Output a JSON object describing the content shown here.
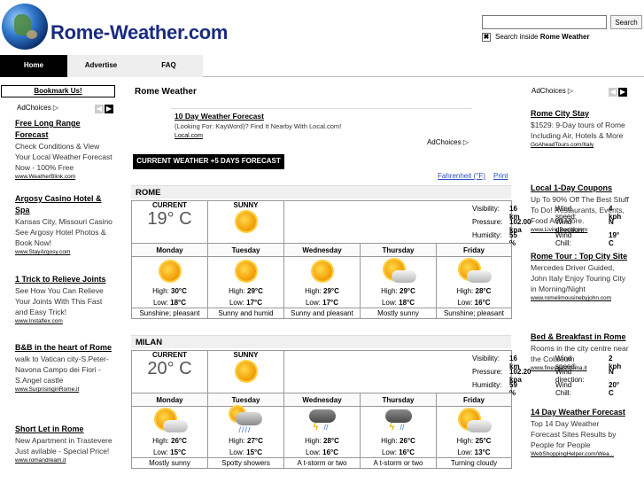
{
  "site": {
    "title": "Rome-Weather.com"
  },
  "search": {
    "button": "Search",
    "option_prefix": "Search inside",
    "option_site": "Rome Weather",
    "check_mark": "✖"
  },
  "nav": {
    "home": "Home",
    "advertise": "Advertise",
    "faq": "FAQ"
  },
  "left": {
    "bookmark": "Bookmark Us!",
    "adchoices": "AdChoices ▷",
    "ads": [
      {
        "title": "Free Long Range Forecast",
        "body": "Check Conditions & View Your Local Weather Forecast Now - 100% Free",
        "url": "www.WeatherBlink.com"
      },
      {
        "title": "Argosy Casino Hotel & Spa",
        "body": "Kansas City, Missouri Casino See Argosy Hotel Photos & Book Now!",
        "url": "www.StayArgosy.com"
      },
      {
        "title": "1 Trick to Relieve Joints",
        "body": "See How You Can Relieve Your Joints With This Fast and Easy Trick!",
        "url": "www.Instaflex.com"
      },
      {
        "title": "B&B in the heart of Rome",
        "body": "walk to Vatican city-S.Peter-Navona Campo dei Fiori -S.Angel castle",
        "url": "www.SurprisinginRome.it"
      },
      {
        "title": "Short Let in Rome",
        "body": "New Apartment in Trastevere Just avilable - Special Price!",
        "url": "www.romandream.it"
      }
    ]
  },
  "center": {
    "title": "Rome Weather",
    "top_ad": {
      "title": "10 Day Weather Forecast",
      "body": "(Looking For: KayWord)? Find It Nearby With Local.com!",
      "url": "Local.com",
      "adchoices": "AdChoices ▷"
    },
    "current_button": "CURRENT WEATHER +5 DAYS FORECAST",
    "fahrenheit": "Fahrenheit (°F)",
    "print": "Print",
    "current_label": "CURRENT",
    "stat_labels": {
      "visibility": "Visibility:",
      "pressure": "Pressure:",
      "humidity": "Humidity:",
      "wind_speed": "Wind speed:",
      "wind_direction": "Wind direction:",
      "wind_chill": "Wind Chill:"
    },
    "hl_labels": {
      "high": "High:",
      "low": "Low:"
    },
    "cities": [
      {
        "name": "ROME",
        "current_temp": "19° C",
        "current_cond": "SUNNY",
        "visibility": "16 km",
        "pressure": "102.00 kpa",
        "humidity": "55 %",
        "wind_speed": "4 kph",
        "wind_direction": "N",
        "wind_chill": "19° C",
        "days": [
          {
            "day": "Monday",
            "icon": "sun-icon",
            "high": "30°C",
            "low": "18°C",
            "cond": "Sunshine; pleasant"
          },
          {
            "day": "Tuesday",
            "icon": "sun-icon",
            "high": "29°C",
            "low": "17°C",
            "cond": "Sunny and humid"
          },
          {
            "day": "Wednesday",
            "icon": "sun-icon",
            "high": "29°C",
            "low": "17°C",
            "cond": "Sunny and pleasant"
          },
          {
            "day": "Thursday",
            "icon": "partly-cloudy-icon",
            "high": "29°C",
            "low": "18°C",
            "cond": "Mostly sunny"
          },
          {
            "day": "Friday",
            "icon": "partly-cloudy-icon",
            "high": "28°C",
            "low": "16°C",
            "cond": "Sunshine; pleasant"
          }
        ]
      },
      {
        "name": "MILAN",
        "current_temp": "20° C",
        "current_cond": "SUNNY",
        "visibility": "16 km",
        "pressure": "102.20 kpa",
        "humidity": "59 %",
        "wind_speed": "2 kph",
        "wind_direction": "N",
        "wind_chill": "20° C",
        "days": [
          {
            "day": "Monday",
            "icon": "partly-cloudy-icon",
            "high": "26°C",
            "low": "15°C",
            "cond": "Mostly sunny"
          },
          {
            "day": "Tuesday",
            "icon": "showers-icon",
            "high": "27°C",
            "low": "15°C",
            "cond": "Spotty showers"
          },
          {
            "day": "Wednesday",
            "icon": "thunderstorm-icon",
            "high": "28°C",
            "low": "16°C",
            "cond": "A t-storm or two"
          },
          {
            "day": "Thursday",
            "icon": "thunderstorm-icon",
            "high": "26°C",
            "low": "16°C",
            "cond": "A t-storm or two"
          },
          {
            "day": "Friday",
            "icon": "partly-cloudy-icon",
            "high": "25°C",
            "low": "13°C",
            "cond": "Turning cloudy"
          }
        ]
      }
    ]
  },
  "right": {
    "adchoices": "AdChoices ▷",
    "ads": [
      {
        "title": "Rome City Stay",
        "body": "$1529: 9-Day tours of Rome Including Air, Hotels & More",
        "url": "GoAheadTours.com/Italy"
      },
      {
        "title": "Local 1-Day Coupons",
        "body": "Up To 90% Off The Best Stuff To Do! Restaurants, Events, Food And More.",
        "url": "www.LivingSocial.com"
      },
      {
        "title": "Rome Tour : Top City Site",
        "body": "Mercedes Driver Guided, John Italy Enjoy Touring City in Morning/Night",
        "url": "www.romelimousinebyjohn.com"
      },
      {
        "title": "Bed & Breakfast in Rome",
        "body": "Rooms in the city centre near the Coliseum",
        "url": "www.finestrasuroma.it"
      },
      {
        "title": "14 Day Weather Forecast",
        "body": "Top 14 Day Weather Forecast Sites Results by People for People",
        "url": "WebShoppingHelper.com/Wea..."
      }
    ]
  },
  "colors": {
    "logo": "#1a2b80",
    "link": "#2a4fbf",
    "nav_active": "#000000"
  }
}
